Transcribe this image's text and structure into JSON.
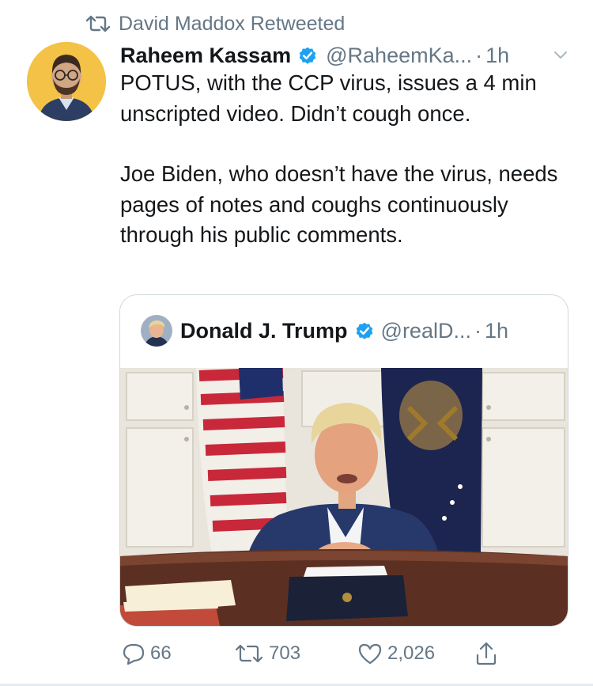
{
  "retweet": {
    "label": "David Maddox Retweeted"
  },
  "tweet": {
    "author_name": "Raheem Kassam",
    "handle": "@RaheemKa...",
    "separator": "·",
    "time": "1h",
    "text": [
      "POTUS, with the CCP virus, issues a 4 min unscripted video. Didn’t cough once.",
      "Joe Biden, who doesn’t have the virus, needs pages of notes and coughs continuously through his public comments."
    ]
  },
  "quoted": {
    "author_name": "Donald J. Trump",
    "handle": "@realD...",
    "separator": "·",
    "time": "1h"
  },
  "actions": {
    "replies": "66",
    "retweets": "703",
    "likes": "2,026"
  },
  "icons": {
    "retweet": "retweet-icon",
    "verified": "verified-badge-icon",
    "more": "chevron-down-icon",
    "reply": "reply-icon",
    "like": "heart-icon",
    "share": "share-icon"
  },
  "colors": {
    "brand_blue": "#1da1f2",
    "secondary_text": "#657786",
    "primary_text": "#14171a",
    "border": "#cfd9de"
  }
}
